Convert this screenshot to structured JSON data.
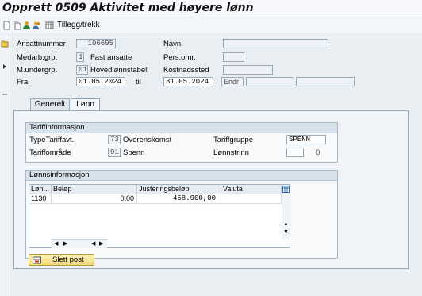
{
  "window": {
    "title": "Opprett 0509 Aktivitet med høyere lønn"
  },
  "toolbar": {
    "icons": [
      "document-icon",
      "copy-icon",
      "person-icon",
      "people-icon",
      "table-icon"
    ],
    "tillegg_label": "Tillegg/trekk"
  },
  "header": {
    "ansattnummer_label": "Ansattnummer",
    "ansattnummer_value": "106695",
    "navn_label": "Navn",
    "navn_value": "",
    "medarb_label": "Medarb.grp.",
    "medarb_code": "1",
    "medarb_text": "Fast ansatte",
    "persomr_label": "Pers.omr.",
    "persomr_value": "",
    "mundergrp_label": "M.undergrp.",
    "mundergrp_code": "01",
    "mundergrp_text": "Hovedlønnstabell",
    "kostnadssted_label": "Kostnadssted",
    "kostnadssted_value": "",
    "fra_label": "Fra",
    "fra_value": "01.05.2024",
    "til_label": "til",
    "til_value": "31.05.2024",
    "endr_label": "Endr"
  },
  "tabs": [
    {
      "label": "Generelt",
      "active": false
    },
    {
      "label": "Lønn",
      "active": true
    }
  ],
  "tariff": {
    "title": "Tariffinformasjon",
    "type_label": "TypeTariffavt.",
    "type_code": "73",
    "type_text": "Overenskomst",
    "gruppe_label": "Tariffgruppe",
    "gruppe_value": "SPENN",
    "omrade_label": "Tariffområde",
    "omrade_code": "91",
    "omrade_text": "Spenn",
    "trinn_label": "Lønnstrinn",
    "trinn_value": "",
    "trinn_extra": "0"
  },
  "lonn": {
    "title": "Lønnsinformasjon",
    "columns": [
      "Løn...",
      "Beløp",
      "Justeringsbeløp",
      "Valuta"
    ],
    "rows": [
      {
        "lonnart": "1130",
        "belop": "0,00",
        "justering": "458.900,00",
        "valuta": ""
      }
    ]
  },
  "actions": {
    "slett_label": "Slett post"
  },
  "colors": {
    "accent_button": "#f0d97a",
    "panel_header": "#d8e2eb"
  }
}
